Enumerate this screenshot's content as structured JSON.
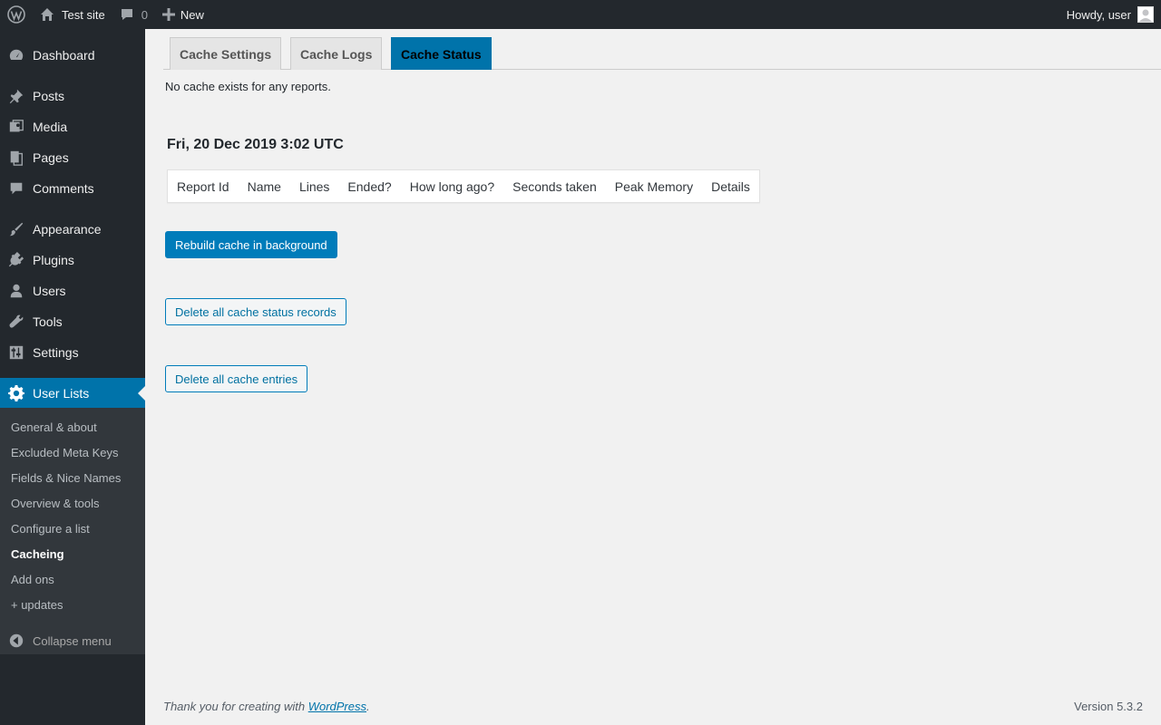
{
  "adminbar": {
    "site_name": "Test site",
    "comments_count": "0",
    "new_label": "New",
    "howdy": "Howdy, user"
  },
  "sidebar": {
    "items": [
      {
        "label": "Dashboard",
        "icon": "dashboard-icon"
      },
      {
        "label": "Posts",
        "icon": "pin-icon"
      },
      {
        "label": "Media",
        "icon": "media-icon"
      },
      {
        "label": "Pages",
        "icon": "pages-icon"
      },
      {
        "label": "Comments",
        "icon": "comment-icon"
      },
      {
        "label": "Appearance",
        "icon": "brush-icon"
      },
      {
        "label": "Plugins",
        "icon": "plug-icon"
      },
      {
        "label": "Users",
        "icon": "user-icon"
      },
      {
        "label": "Tools",
        "icon": "wrench-icon"
      },
      {
        "label": "Settings",
        "icon": "sliders-icon"
      },
      {
        "label": "User Lists",
        "icon": "gear-icon",
        "current": true
      }
    ],
    "submenu": [
      {
        "label": "General & about"
      },
      {
        "label": "Excluded Meta Keys"
      },
      {
        "label": "Fields & Nice Names"
      },
      {
        "label": "Overview & tools"
      },
      {
        "label": "Configure a list"
      },
      {
        "label": "Cacheing",
        "current": true
      },
      {
        "label": "Add ons"
      },
      {
        "label": "+ updates"
      }
    ],
    "collapse_label": "Collapse menu"
  },
  "tabs": [
    {
      "label": "Cache Settings"
    },
    {
      "label": "Cache Logs"
    },
    {
      "label": "Cache Status",
      "active": true
    }
  ],
  "main": {
    "notice": "No cache exists for any reports.",
    "date_heading": "Fri, 20 Dec 2019 3:02 UTC",
    "table_headers": [
      "Report Id",
      "Name",
      "Lines",
      "Ended?",
      "How long ago?",
      "Seconds taken",
      "Peak Memory",
      "Details"
    ],
    "rebuild_button": "Rebuild cache in background",
    "delete_status_button": "Delete all cache status records",
    "delete_entries_button": "Delete all cache entries"
  },
  "footer": {
    "thanks_prefix": "Thank you for creating with ",
    "wordpress_link": "WordPress",
    "thanks_suffix": ".",
    "version": "Version 5.3.2"
  },
  "colors": {
    "adminbar_bg": "#23282d",
    "accent": "#0073aa",
    "submenu_bg": "#32373c",
    "page_bg": "#f1f1f1"
  }
}
